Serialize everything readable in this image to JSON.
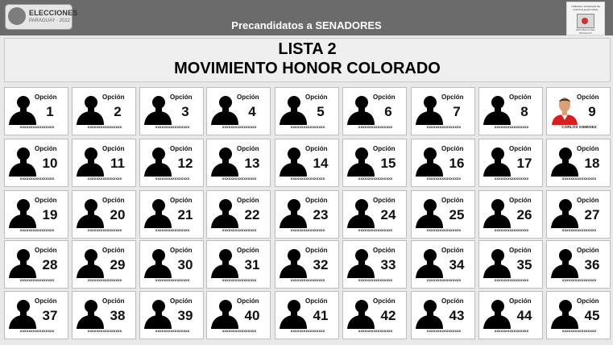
{
  "header": {
    "logo_left": {
      "brand": "ELECCIONES",
      "sub": "PARAGUAY · 2022"
    },
    "title": "Precandidatos a SENADORES",
    "logo_right": {
      "top_text": "TRIBUNAL SUPERIOR DE JUSTICIA ELECTORAL",
      "bottom_text": "REPÚBLICA DEL PARAGUAY"
    }
  },
  "banner": {
    "lista": "LISTA 2",
    "movimiento": "MOVIMIENTO HONOR COLORADO"
  },
  "option_label": "Opción",
  "candidates": [
    {
      "num": "1",
      "name": "xxxxxxxxxxxxxxxx"
    },
    {
      "num": "2",
      "name": "xxxxxxxxxxxxxxxx"
    },
    {
      "num": "3",
      "name": "xxxxxxxxxxxxxxxx"
    },
    {
      "num": "4",
      "name": "xxxxxxxxxxxxxxxx"
    },
    {
      "num": "5",
      "name": "xxxxxxxxxxxxxxxx"
    },
    {
      "num": "6",
      "name": "xxxxxxxxxxxxxxxx"
    },
    {
      "num": "7",
      "name": "xxxxxxxxxxxxxxxx"
    },
    {
      "num": "8",
      "name": "xxxxxxxxxxxxxxxx"
    },
    {
      "num": "9",
      "name": "CARLOS GIMENEZ"
    },
    {
      "num": "10",
      "name": "xxxxxxxxxxxxxxxx"
    },
    {
      "num": "11",
      "name": "xxxxxxxxxxxxxxxx"
    },
    {
      "num": "12",
      "name": "xxxxxxxxxxxxxxxx"
    },
    {
      "num": "13",
      "name": "xxxxxxxxxxxxxxxx"
    },
    {
      "num": "14",
      "name": "xxxxxxxxxxxxxxxx"
    },
    {
      "num": "15",
      "name": "xxxxxxxxxxxxxxxx"
    },
    {
      "num": "16",
      "name": "xxxxxxxxxxxxxxxx"
    },
    {
      "num": "17",
      "name": "xxxxxxxxxxxxxxxx"
    },
    {
      "num": "18",
      "name": "xxxxxxxxxxxxxxxx"
    },
    {
      "num": "19",
      "name": "xxxxxxxxxxxxxxxx"
    },
    {
      "num": "20",
      "name": "xxxxxxxxxxxxxxxx"
    },
    {
      "num": "21",
      "name": "xxxxxxxxxxxxxxxx"
    },
    {
      "num": "22",
      "name": "xxxxxxxxxxxxxxxx"
    },
    {
      "num": "23",
      "name": "xxxxxxxxxxxxxxxx"
    },
    {
      "num": "24",
      "name": "xxxxxxxxxxxxxxxx"
    },
    {
      "num": "25",
      "name": "xxxxxxxxxxxxxxxx"
    },
    {
      "num": "26",
      "name": "xxxxxxxxxxxxxxxx"
    },
    {
      "num": "27",
      "name": "xxxxxxxxxxxxxxxx"
    },
    {
      "num": "28",
      "name": "xxxxxxxxxxxxxxxx"
    },
    {
      "num": "29",
      "name": "xxxxxxxxxxxxxxxx"
    },
    {
      "num": "30",
      "name": "xxxxxxxxxxxxxxxx"
    },
    {
      "num": "31",
      "name": "xxxxxxxxxxxxxxxx"
    },
    {
      "num": "32",
      "name": "xxxxxxxxxxxxxxxx"
    },
    {
      "num": "33",
      "name": "xxxxxxxxxxxxxxxx"
    },
    {
      "num": "34",
      "name": "xxxxxxxxxxxxxxxx"
    },
    {
      "num": "35",
      "name": "xxxxxxxxxxxxxxxx"
    },
    {
      "num": "36",
      "name": "xxxxxxxxxxxxxxxx"
    },
    {
      "num": "37",
      "name": "xxxxxxxxxxxxxxxx"
    },
    {
      "num": "38",
      "name": "xxxxxxxxxxxxxxxx"
    },
    {
      "num": "39",
      "name": "xxxxxxxxxxxxxxxx"
    },
    {
      "num": "40",
      "name": "xxxxxxxxxxxxxxxx"
    },
    {
      "num": "41",
      "name": "xxxxxxxxxxxxxxxx"
    },
    {
      "num": "42",
      "name": "xxxxxxxxxxxxxxxx"
    },
    {
      "num": "43",
      "name": "xxxxxxxxxxxxxxxx"
    },
    {
      "num": "44",
      "name": "xxxxxxxxxxxxxxxx"
    },
    {
      "num": "45",
      "name": "xxxxxxxxxxxxxxxx"
    }
  ],
  "photo_candidate_num": "9",
  "colors": {
    "header_bg": "#6b6b6b",
    "page_bg": "#e9e9e9",
    "card_bg": "#ffffff",
    "silhouette": "#000000"
  }
}
